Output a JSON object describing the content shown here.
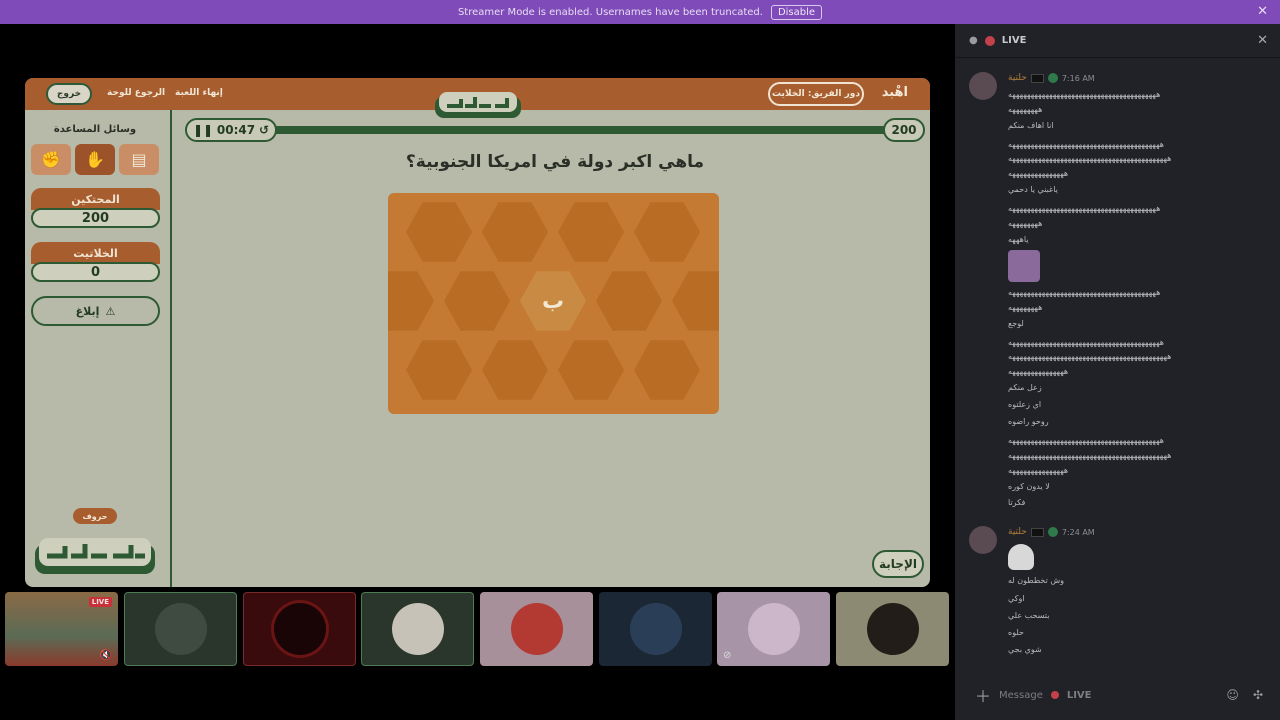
{
  "banner": {
    "text": "Streamer Mode is enabled. Usernames have been truncated.",
    "disable_label": "Disable",
    "close_glyph": "✕"
  },
  "game": {
    "exit_label": "خروج",
    "back_label": "الرجوع للوحة",
    "end_label": "إنهاء اللعبة",
    "team_pill": "دور الفريق: الخلايت",
    "team_name": "اهْبد",
    "timer": "00:47",
    "top_score": "200",
    "question": "ماهي اكبر دولة في امريكا الجنوبية؟",
    "center_letter": "ب",
    "answer_label": "الإجابة",
    "help_title": "وسائل المساعدة",
    "team1_name": "المحتكين",
    "team1_score": "200",
    "team2_name": "الخلاتيت",
    "team2_score": "0",
    "report_label": "إبلاغ",
    "letters_tag": "حروف"
  },
  "participants": [
    {
      "color": "#7a5a3a",
      "live": "LIVE"
    },
    {
      "color": "#3a4a3c"
    },
    {
      "color": "#3a0e10"
    },
    {
      "color": "#c6c2b8"
    },
    {
      "color": "#b23a32"
    },
    {
      "color": "#1f2e3f"
    },
    {
      "color": "#b7a1b5"
    },
    {
      "color": "#3c3528"
    }
  ],
  "chat": {
    "channel": "LIVE",
    "input_placeholder": "Message",
    "input_channel": "LIVE",
    "group1": {
      "user": "حلتية",
      "time": "7:16 AM",
      "lines": [
        "ههههههههههههههههههههههههههههههههههههههههه",
        "ههههههههه",
        "انا اهاف منكم",
        "هههههههههههههههههههههههههههههههههههههههههه",
        "هههههههههههههههههههههههههههههههههههههههههههه",
        "هههههههههههههههه",
        "ياغبني يا دحمي",
        "ههههههههههههههههههههههههههههههههههههههههه",
        "ههههههههه",
        "ياهههه",
        "ههههههههههههههههههههههههههههههههههههههههه",
        "ههههههههه",
        "لوجع",
        "هههههههههههههههههههههههههههههههههههههههههه",
        "هههههههههههههههههههههههههههههههههههههههههههه",
        "هههههههههههههههه",
        "زعل منكم",
        "اي زعلتوه",
        "روحو راضوه",
        "هههههههههههههههههههههههههههههههههههههههههه",
        "هههههههههههههههههههههههههههههههههههههههههههه",
        "هههههههههههههههه",
        "لا يدون كوره",
        "فكرتا"
      ]
    },
    "group2": {
      "user": "حلتية",
      "time": "7:24 AM",
      "lines": [
        "وش تخططون له",
        "اوكي",
        "بتسحب علي",
        "حلوه",
        "شوي بجي"
      ]
    }
  }
}
